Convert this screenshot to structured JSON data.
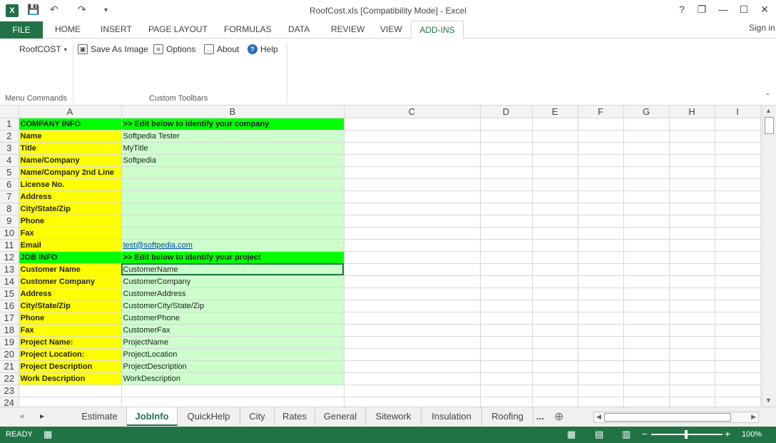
{
  "window": {
    "title": "RoofCost.xls  [Compatibility Mode] - Excel",
    "app_icon": "X",
    "help_glyph": "?",
    "restore_glyph": "❐",
    "min_glyph": "—",
    "max_glyph": "☐",
    "close_glyph": "✕",
    "undo_glyph": "↶",
    "redo_glyph": "↷",
    "save_glyph": "💾",
    "customize_glyph": "▾"
  },
  "menu": {
    "file": "FILE",
    "tabs": [
      "HOME",
      "INSERT",
      "PAGE LAYOUT",
      "FORMULAS",
      "DATA",
      "REVIEW",
      "VIEW"
    ],
    "active": "ADD-INS",
    "sign_in": "Sign in"
  },
  "ribbon": {
    "roofcost": "RoofCOST",
    "save_image": "Save As Image",
    "options": "Options",
    "about": "About",
    "help": "Help",
    "group1": "Menu Commands",
    "group2": "Custom Toolbars"
  },
  "sheet": {
    "columns": [
      "A",
      "B",
      "C",
      "D",
      "E",
      "F",
      "G",
      "H",
      "I"
    ],
    "rows": [
      {
        "n": "1",
        "a": "COMPANY INFO",
        "b": ">> Edit below to identify your company"
      },
      {
        "n": "2",
        "a": "Name",
        "b": "Softpedia Tester"
      },
      {
        "n": "3",
        "a": "Title",
        "b": "MyTitle"
      },
      {
        "n": "4",
        "a": "Name/Company",
        "b": "Softpedia"
      },
      {
        "n": "5",
        "a": "Name/Company 2nd Line",
        "b": ""
      },
      {
        "n": "6",
        "a": "License No.",
        "b": ""
      },
      {
        "n": "7",
        "a": "Address",
        "b": ""
      },
      {
        "n": "8",
        "a": "City/State/Zip",
        "b": ""
      },
      {
        "n": "9",
        "a": "Phone",
        "b": ""
      },
      {
        "n": "10",
        "a": "Fax",
        "b": ""
      },
      {
        "n": "11",
        "a": "Email",
        "b": "test@softpedia.com"
      },
      {
        "n": "12",
        "a": "JOB INFO",
        "b": ">> Edit below to identify your project"
      },
      {
        "n": "13",
        "a": "Customer Name",
        "b": "CustomerName"
      },
      {
        "n": "14",
        "a": "Customer Company",
        "b": "CustomerCompany"
      },
      {
        "n": "15",
        "a": "Address",
        "b": "CustomerAddress"
      },
      {
        "n": "16",
        "a": "City/State/Zip",
        "b": "CustomerCity/State/Zip"
      },
      {
        "n": "17",
        "a": "Phone",
        "b": "CustomerPhone"
      },
      {
        "n": "18",
        "a": "Fax",
        "b": "CustomerFax"
      },
      {
        "n": "19",
        "a": "Project Name:",
        "b": "ProjectName"
      },
      {
        "n": "20",
        "a": "Project Location:",
        "b": "ProjectLocation"
      },
      {
        "n": "21",
        "a": "Project Description",
        "b": "ProjectDescription"
      },
      {
        "n": "22",
        "a": "Work Description",
        "b": "WorkDescription"
      },
      {
        "n": "23",
        "a": "",
        "b": ""
      },
      {
        "n": "24",
        "a": "",
        "b": ""
      }
    ]
  },
  "tabs": {
    "sheets": [
      "Estimate",
      "JobInfo",
      "QuickHelp",
      "City",
      "Rates",
      "General",
      "Sitework",
      "Insulation",
      "Roofing"
    ],
    "more": "...",
    "add": "⊕",
    "prev": "◂",
    "next": "▸"
  },
  "status": {
    "ready": "READY",
    "zoom": "100%",
    "minus": "−",
    "plus": "+"
  },
  "colors": {
    "excel_green": "#217346",
    "yellow": "#ffff00",
    "green": "#00ff00",
    "light_green": "#ccffcc"
  }
}
